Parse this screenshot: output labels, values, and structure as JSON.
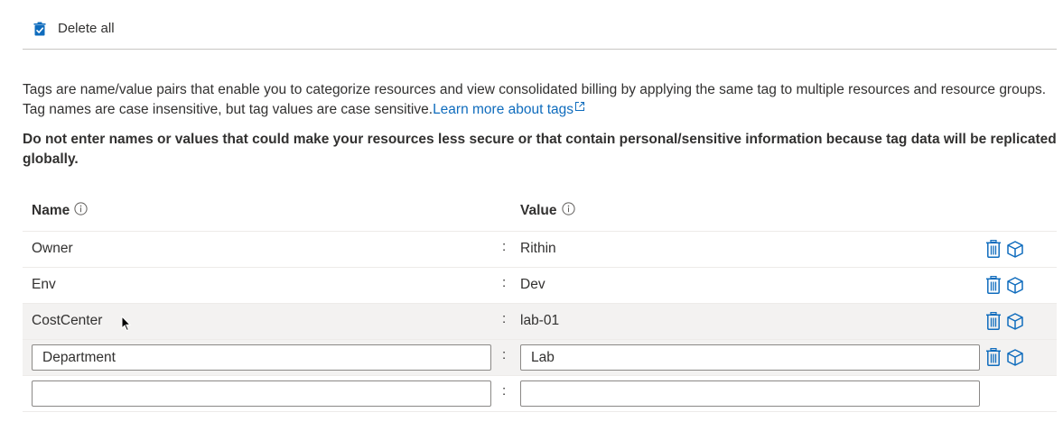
{
  "toolbar": {
    "delete_all_label": "Delete all"
  },
  "description": {
    "text": "Tags are name/value pairs that enable you to categorize resources and view consolidated billing by applying the same tag to multiple resources and resource groups. Tag names are case insensitive, but tag values are case sensitive.",
    "link_text": "Learn more about tags"
  },
  "warning": "Do not enter names or values that could make your resources less secure or that contain personal/sensitive information because tag data will be replicated globally.",
  "table": {
    "header_name": "Name",
    "header_value": "Value",
    "colon": ":",
    "rows": [
      {
        "name": "Owner",
        "value": "Rithin"
      },
      {
        "name": "Env",
        "value": "Dev"
      },
      {
        "name": "CostCenter",
        "value": "lab-01"
      }
    ],
    "edit_row": {
      "name": "Department",
      "value": "Lab"
    },
    "new_row": {
      "name": "",
      "value": ""
    }
  },
  "icons": {
    "delete_all": "delete-all-checkbox-icon",
    "info": "info-icon",
    "delete": "trash-icon",
    "apply": "cube-icon",
    "external": "external-link-icon"
  },
  "colors": {
    "accent": "#0f6cbd",
    "text": "#323130",
    "row_hover": "#f3f2f1"
  }
}
